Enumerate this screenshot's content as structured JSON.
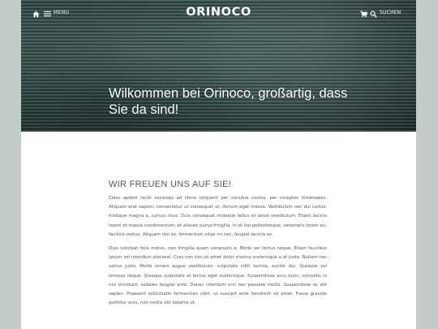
{
  "header": {
    "home_icon": "home-icon",
    "menu_icon": "hamburger-icon",
    "menu_label": "MENU",
    "logo": "ORINOCO",
    "cart_icon": "cart-icon",
    "search_icon": "search-icon",
    "search_label": "SUCHEN"
  },
  "hero": {
    "title": "Wilkommen bei Orinoco, großartig, dass Sie da sind!"
  },
  "main": {
    "heading": "WIR FREUEN UNS AUF SIE!",
    "paragraphs": [
      "Class aptent taciti sociosqu ad litora torquent per conubia nostra, per inceptos himenaeos. Aliquam erat sapien, consectetur ut consequat ut, dictum eget massa. Vestibulum nec dui luctus, tristique magna a, cursus risus. Duis consequat molestie tellus sit amet vestibulum. Etiam lacinia lorem et massa condimentum, et aliquet purus fringilla. In et leo pellentesque, venenatis lorem eu, facilisis metus. Aliquam nisi ex, fermentum vitae mi nec, feugiat lacinia ex.",
      "Duis volutpat felis metus, non fringilla quam venenatis a. Morbi vel lectus neque. Etiam faucibus ipsum vel interdum placerat. Cras non nisi sit amet dolor viverra scelerisque a at justo. Nullam nec varius justo. Morbi ornare augue vestibulum, vulputate nibh lacinia, auctor dui. Quisque vel tempus neque. Quisque vulputate et lectus eget scelerisque. Suspendisse arcu nunc, convallis in nisi tincidunt, sodales feugiat ante. Donec interdum orci nec posuere mollis. Suspendisse ac elit sapien. Praesent sollicitudin fermentum nibh, ut suscipit ante hendrerit sit amet. Fusce gravida porttitor eros, non mollis elit lobortis ut."
    ]
  },
  "colors": {
    "background": "#c3cdc8",
    "text": "#555555",
    "header_text": "#ffffff"
  }
}
